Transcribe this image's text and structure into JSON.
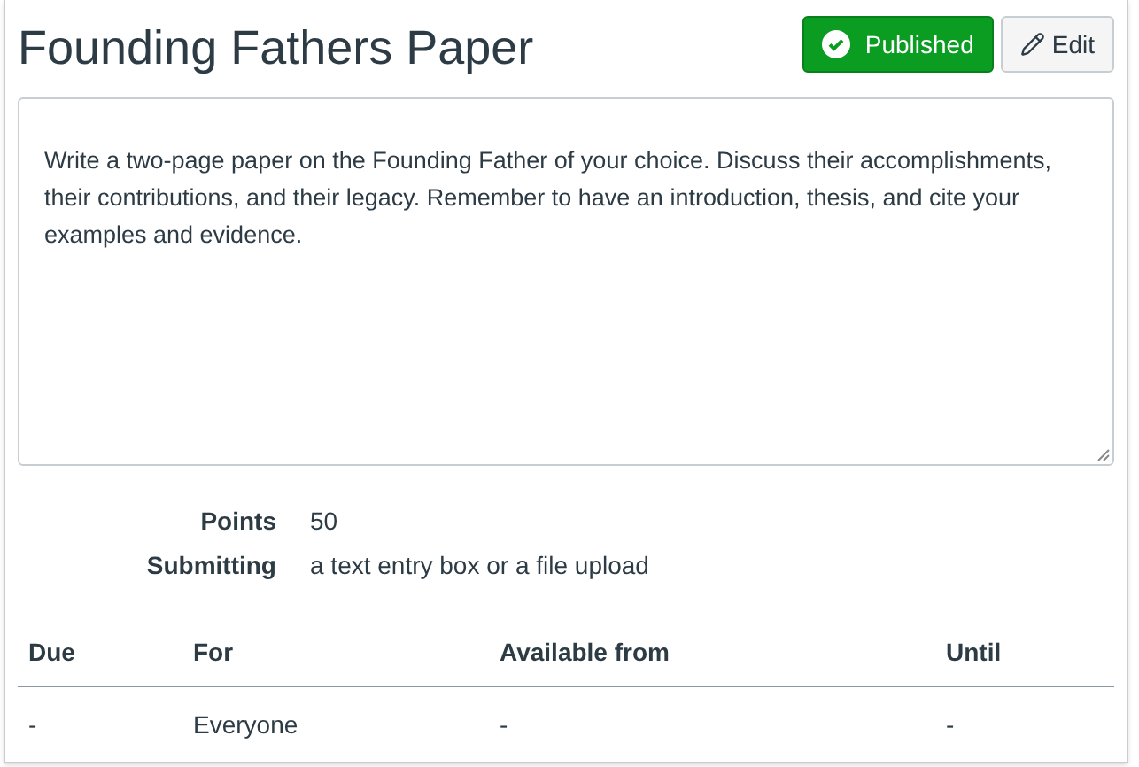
{
  "title": "Founding Fathers Paper",
  "publish_button": {
    "label": "Published",
    "published": true
  },
  "edit_button": {
    "label": "Edit"
  },
  "description": "Write a two-page paper on the Founding Father of your choice. Discuss their accomplishments, their contributions, and their legacy. Remember to have an introduction, thesis, and cite your examples and evidence.",
  "details": [
    {
      "label": "Points",
      "value": "50"
    },
    {
      "label": "Submitting",
      "value": "a text entry box or a file upload"
    }
  ],
  "table": {
    "columns": [
      "Due",
      "For",
      "Available from",
      "Until"
    ],
    "rows": [
      [
        "-",
        "Everyone",
        "-",
        "-"
      ]
    ]
  }
}
